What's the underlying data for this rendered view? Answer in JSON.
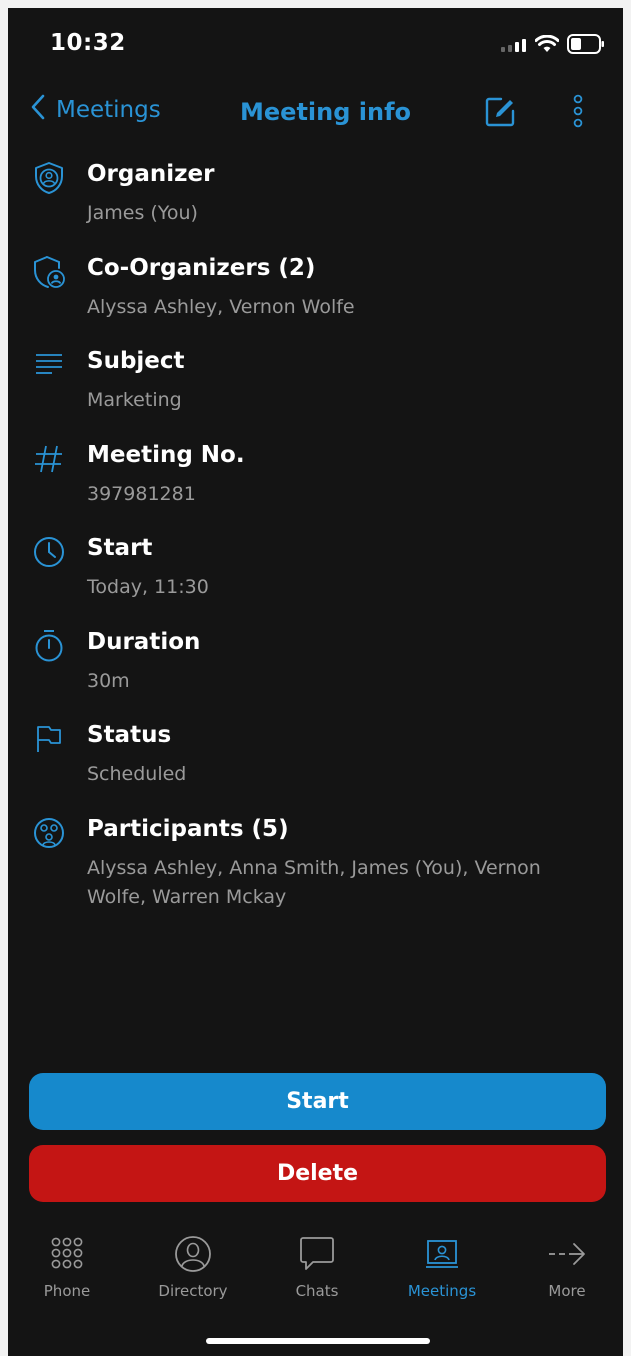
{
  "status_bar": {
    "time": "10:32"
  },
  "nav": {
    "back_label": "Meetings",
    "title": "Meeting info"
  },
  "info": [
    {
      "title": "Organizer",
      "value": "James (You)",
      "icon": "shield-user-icon"
    },
    {
      "title": "Co-Organizers (2)",
      "value": "Alyssa Ashley, Vernon Wolfe",
      "icon": "shield-add-user-icon"
    },
    {
      "title": "Subject",
      "value": "Marketing",
      "icon": "text-lines-icon"
    },
    {
      "title": "Meeting No.",
      "value": "397981281",
      "icon": "hash-icon"
    },
    {
      "title": "Start",
      "value": "Today, 11:30",
      "icon": "clock-icon"
    },
    {
      "title": "Duration",
      "value": "30m",
      "icon": "stopwatch-icon"
    },
    {
      "title": "Status",
      "value": "Scheduled",
      "icon": "flag-icon"
    },
    {
      "title": "Participants (5)",
      "value": "Alyssa Ashley, Anna Smith, James (You), Vernon Wolfe, Warren Mckay",
      "icon": "participants-icon"
    }
  ],
  "actions": {
    "start_label": "Start",
    "delete_label": "Delete"
  },
  "tabs": [
    {
      "label": "Phone",
      "icon": "dialpad-icon",
      "active": false
    },
    {
      "label": "Directory",
      "icon": "person-circle-icon",
      "active": false
    },
    {
      "label": "Chats",
      "icon": "chat-bubble-icon",
      "active": false
    },
    {
      "label": "Meetings",
      "icon": "meetings-icon",
      "active": true
    },
    {
      "label": "More",
      "icon": "arrow-right-icon",
      "active": false
    }
  ],
  "colors": {
    "accent": "#2a93d5",
    "start": "#1689cc",
    "delete": "#c41514",
    "background": "#141414",
    "secondary_text": "#9a9a9a"
  }
}
